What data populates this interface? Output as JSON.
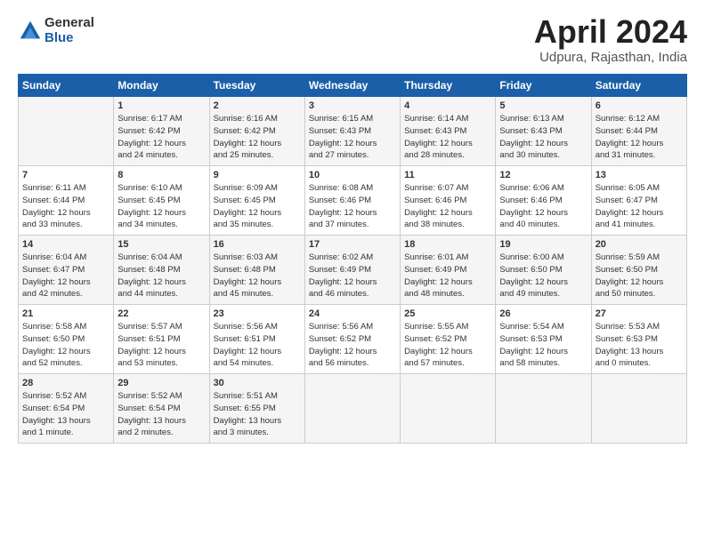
{
  "logo": {
    "general": "General",
    "blue": "Blue"
  },
  "title": "April 2024",
  "location": "Udpura, Rajasthan, India",
  "header_days": [
    "Sunday",
    "Monday",
    "Tuesday",
    "Wednesday",
    "Thursday",
    "Friday",
    "Saturday"
  ],
  "weeks": [
    [
      {
        "day": "",
        "info": ""
      },
      {
        "day": "1",
        "info": "Sunrise: 6:17 AM\nSunset: 6:42 PM\nDaylight: 12 hours\nand 24 minutes."
      },
      {
        "day": "2",
        "info": "Sunrise: 6:16 AM\nSunset: 6:42 PM\nDaylight: 12 hours\nand 25 minutes."
      },
      {
        "day": "3",
        "info": "Sunrise: 6:15 AM\nSunset: 6:43 PM\nDaylight: 12 hours\nand 27 minutes."
      },
      {
        "day": "4",
        "info": "Sunrise: 6:14 AM\nSunset: 6:43 PM\nDaylight: 12 hours\nand 28 minutes."
      },
      {
        "day": "5",
        "info": "Sunrise: 6:13 AM\nSunset: 6:43 PM\nDaylight: 12 hours\nand 30 minutes."
      },
      {
        "day": "6",
        "info": "Sunrise: 6:12 AM\nSunset: 6:44 PM\nDaylight: 12 hours\nand 31 minutes."
      }
    ],
    [
      {
        "day": "7",
        "info": "Sunrise: 6:11 AM\nSunset: 6:44 PM\nDaylight: 12 hours\nand 33 minutes."
      },
      {
        "day": "8",
        "info": "Sunrise: 6:10 AM\nSunset: 6:45 PM\nDaylight: 12 hours\nand 34 minutes."
      },
      {
        "day": "9",
        "info": "Sunrise: 6:09 AM\nSunset: 6:45 PM\nDaylight: 12 hours\nand 35 minutes."
      },
      {
        "day": "10",
        "info": "Sunrise: 6:08 AM\nSunset: 6:46 PM\nDaylight: 12 hours\nand 37 minutes."
      },
      {
        "day": "11",
        "info": "Sunrise: 6:07 AM\nSunset: 6:46 PM\nDaylight: 12 hours\nand 38 minutes."
      },
      {
        "day": "12",
        "info": "Sunrise: 6:06 AM\nSunset: 6:46 PM\nDaylight: 12 hours\nand 40 minutes."
      },
      {
        "day": "13",
        "info": "Sunrise: 6:05 AM\nSunset: 6:47 PM\nDaylight: 12 hours\nand 41 minutes."
      }
    ],
    [
      {
        "day": "14",
        "info": "Sunrise: 6:04 AM\nSunset: 6:47 PM\nDaylight: 12 hours\nand 42 minutes."
      },
      {
        "day": "15",
        "info": "Sunrise: 6:04 AM\nSunset: 6:48 PM\nDaylight: 12 hours\nand 44 minutes."
      },
      {
        "day": "16",
        "info": "Sunrise: 6:03 AM\nSunset: 6:48 PM\nDaylight: 12 hours\nand 45 minutes."
      },
      {
        "day": "17",
        "info": "Sunrise: 6:02 AM\nSunset: 6:49 PM\nDaylight: 12 hours\nand 46 minutes."
      },
      {
        "day": "18",
        "info": "Sunrise: 6:01 AM\nSunset: 6:49 PM\nDaylight: 12 hours\nand 48 minutes."
      },
      {
        "day": "19",
        "info": "Sunrise: 6:00 AM\nSunset: 6:50 PM\nDaylight: 12 hours\nand 49 minutes."
      },
      {
        "day": "20",
        "info": "Sunrise: 5:59 AM\nSunset: 6:50 PM\nDaylight: 12 hours\nand 50 minutes."
      }
    ],
    [
      {
        "day": "21",
        "info": "Sunrise: 5:58 AM\nSunset: 6:50 PM\nDaylight: 12 hours\nand 52 minutes."
      },
      {
        "day": "22",
        "info": "Sunrise: 5:57 AM\nSunset: 6:51 PM\nDaylight: 12 hours\nand 53 minutes."
      },
      {
        "day": "23",
        "info": "Sunrise: 5:56 AM\nSunset: 6:51 PM\nDaylight: 12 hours\nand 54 minutes."
      },
      {
        "day": "24",
        "info": "Sunrise: 5:56 AM\nSunset: 6:52 PM\nDaylight: 12 hours\nand 56 minutes."
      },
      {
        "day": "25",
        "info": "Sunrise: 5:55 AM\nSunset: 6:52 PM\nDaylight: 12 hours\nand 57 minutes."
      },
      {
        "day": "26",
        "info": "Sunrise: 5:54 AM\nSunset: 6:53 PM\nDaylight: 12 hours\nand 58 minutes."
      },
      {
        "day": "27",
        "info": "Sunrise: 5:53 AM\nSunset: 6:53 PM\nDaylight: 13 hours\nand 0 minutes."
      }
    ],
    [
      {
        "day": "28",
        "info": "Sunrise: 5:52 AM\nSunset: 6:54 PM\nDaylight: 13 hours\nand 1 minute."
      },
      {
        "day": "29",
        "info": "Sunrise: 5:52 AM\nSunset: 6:54 PM\nDaylight: 13 hours\nand 2 minutes."
      },
      {
        "day": "30",
        "info": "Sunrise: 5:51 AM\nSunset: 6:55 PM\nDaylight: 13 hours\nand 3 minutes."
      },
      {
        "day": "",
        "info": ""
      },
      {
        "day": "",
        "info": ""
      },
      {
        "day": "",
        "info": ""
      },
      {
        "day": "",
        "info": ""
      }
    ]
  ]
}
